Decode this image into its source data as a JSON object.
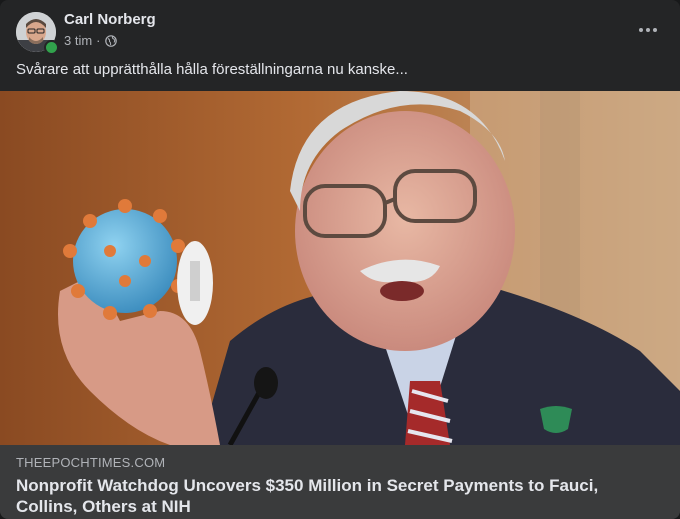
{
  "post": {
    "author": "Carl Norberg",
    "time": "3 tim",
    "separator": "·",
    "privacy_icon": "globe-icon",
    "more_icon": "more-options-icon",
    "text": "Svårare att upprätthålla hålla föreställningarna nu kanske..."
  },
  "link": {
    "domain": "THEEPOCHTIMES.COM",
    "title": "Nonprofit Watchdog Uncovers $350 Million in Secret Payments to Fauci, Collins, Others at NIH"
  },
  "colors": {
    "card_bg": "#242526",
    "footer_bg": "#3a3b3c",
    "primary_text": "#e4e6eb",
    "secondary_text": "#b0b3b8",
    "online": "#31a24c"
  }
}
